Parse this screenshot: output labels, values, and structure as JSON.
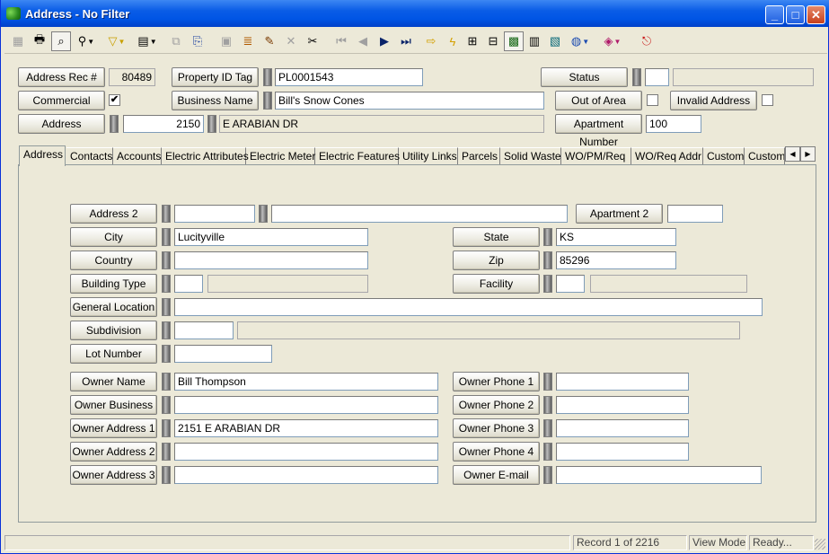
{
  "window": {
    "title": "Address - No Filter",
    "minimize": "_",
    "maximize": "□",
    "close": "✕"
  },
  "toolbar": {
    "icons": [
      "new-icon",
      "print-icon",
      "preview-icon",
      "find-icon",
      "filter-icon",
      "report-icon",
      "copy-icon",
      "paste-icon",
      "save-icon",
      "stack-icon",
      "edit-icon",
      "delete-icon",
      "cut-icon",
      "first-record-icon",
      "prev-record-icon",
      "next-record-icon",
      "last-record-icon",
      "goto-icon",
      "lightning-icon",
      "map-icon",
      "tree-icon",
      "chart-icon",
      "calculator-icon",
      "globe-map-icon",
      "world-icon",
      "book-icon",
      "exit-icon"
    ]
  },
  "header": {
    "address_rec_label": "Address Rec #",
    "address_rec_value": "80489",
    "property_id_label": "Property ID Tag",
    "property_id_value": "PL0001543",
    "status_label": "Status",
    "status_code": "",
    "status_desc": "",
    "commercial_label": "Commercial",
    "commercial_checked": "✔",
    "business_name_label": "Business Name",
    "business_name_value": "Bill's Snow Cones",
    "out_of_area_label": "Out of Area",
    "invalid_address_label": "Invalid Address",
    "address_label": "Address",
    "address_number": "2150",
    "address_street": "E ARABIAN DR",
    "apartment_number_label": "Apartment Number",
    "apartment_number_value": "100"
  },
  "tabs": [
    {
      "label": "Address"
    },
    {
      "label": "Contacts"
    },
    {
      "label": "Accounts"
    },
    {
      "label": "Electric Attributes"
    },
    {
      "label": "Electric Meter"
    },
    {
      "label": "Electric Features"
    },
    {
      "label": "Utility Links"
    },
    {
      "label": "Parcels"
    },
    {
      "label": "Solid Waste"
    },
    {
      "label": "WO/PM/Req"
    },
    {
      "label": "WO/Req Addr"
    },
    {
      "label": "Custom"
    },
    {
      "label": "Custom"
    }
  ],
  "form": {
    "address2_label": "Address 2",
    "address2_a": "",
    "address2_b": "",
    "apartment2_label": "Apartment 2",
    "apartment2_value": "",
    "city_label": "City",
    "city_value": "Lucityville",
    "state_label": "State",
    "state_value": "KS",
    "country_label": "Country",
    "country_value": "",
    "zip_label": "Zip",
    "zip_value": "85296",
    "building_type_label": "Building Type",
    "building_type_code": "",
    "building_type_desc": "",
    "facility_label": "Facility",
    "facility_code": "",
    "facility_desc": "",
    "general_location_label": "General Location",
    "general_location_value": "",
    "subdivision_label": "Subdivision",
    "subdivision_code": "",
    "subdivision_desc": "",
    "lot_number_label": "Lot Number",
    "lot_number_value": "",
    "owner_name_label": "Owner Name",
    "owner_name_value": "Bill Thompson",
    "owner_business_label": "Owner Business",
    "owner_business_value": "",
    "owner_address1_label": "Owner Address 1",
    "owner_address1_value": "2151 E ARABIAN DR",
    "owner_address2_label": "Owner Address 2",
    "owner_address2_value": "",
    "owner_address3_label": "Owner Address 3",
    "owner_address3_value": "",
    "owner_phone1_label": "Owner Phone 1",
    "owner_phone1_value": "",
    "owner_phone2_label": "Owner Phone 2",
    "owner_phone2_value": "",
    "owner_phone3_label": "Owner Phone 3",
    "owner_phone3_value": "",
    "owner_phone4_label": "Owner Phone 4",
    "owner_phone4_value": "",
    "owner_email_label": "Owner E-mail",
    "owner_email_value": ""
  },
  "statusbar": {
    "record": "Record 1 of 2216",
    "mode": "View Mode",
    "state": "Ready..."
  },
  "colors": {
    "titlebar": "#0055e5",
    "window_bg": "#ece9d8"
  }
}
